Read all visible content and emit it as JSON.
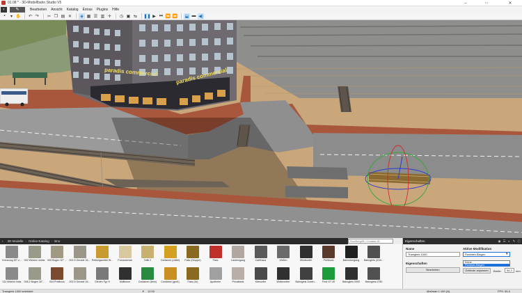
{
  "window": {
    "title": "01.08 * - 3D-Modellbahn Studio V5",
    "minimize": "–",
    "maximize": "□",
    "close": "✕"
  },
  "menubar": {
    "items": [
      "Bearbeiten",
      "Ansicht",
      "Katalog",
      "Extras",
      "Plugins",
      "Hilfe"
    ]
  },
  "scene": {
    "building_sign_1": "paradis commercial",
    "building_sign_2": "paradis commercial"
  },
  "catalog": {
    "breadcrumb": [
      "3D-Modelle",
      "Online-Katalog",
      "Bno"
    ],
    "search_placeholder": "Suchbegriff / Content-ID",
    "items_row1": [
      "Kreuzung 90° z...",
      "002 Weiche rechts",
      "005 Bogen 30° ...",
      "002.5 Gerade 16...",
      "Rettungsmittel W...",
      "Fotoautomat",
      "Tafik 2",
      "Container (mittel)",
      "Fass (Gruppe)",
      "Fass",
      "Laubengang",
      "Caféhaus",
      "Wellen",
      "Windkurfer",
      "Prellbock",
      "Bahnübergang",
      "Bahngleis (410r..."
    ],
    "items_row2": [
      "011 Weiche links",
      "006.2 Bogen 30°...",
      "004 Prellbock",
      "002.5 Gerade 16...",
      "Citroën Typ H",
      "Mülltonne",
      "Container (klein)",
      "Container (groß)",
      "Fass (4x)",
      "Apotheke",
      "Privatbank",
      "Kitesurfer",
      "Wellenreiter",
      "Bahngleis Zubeh...",
      "Ford GT 40",
      "Bahngleis 0900",
      "Bahngleis 0750"
    ],
    "row1_colors": [
      "#8a8a8a",
      "#9a9a8a",
      "#a09a85",
      "#9a968a",
      "#c89a30",
      "#d8c8a0",
      "#c8b070",
      "#d4a020",
      "#8a6a20",
      "#c0302a",
      "#b0a8a0",
      "#5a5a5a",
      "#6a6a6a",
      "#303030",
      "#5a3a2a",
      "#202020",
      "#505050"
    ],
    "row2_colors": [
      "#8a8a8a",
      "#9a9a8a",
      "#7a4a30",
      "#9a968a",
      "#7a7a7a",
      "#303030",
      "#2a8a40",
      "#c89020",
      "#8a6a20",
      "#a0a0a0",
      "#b8b0a8",
      "#4a4a4a",
      "#303030",
      "#404040",
      "#1a9a3a",
      "#303030",
      "#505050"
    ]
  },
  "properties": {
    "header": "Eigenschaften",
    "name_label": "Name",
    "name_value": "Tramgleis 1000",
    "props_label": "Eigenschaften",
    "edit_button": "Bearbeiten",
    "modification_label": "Aktive Modifikation",
    "modification_value": "Flexibles Biegen",
    "dropdown_options": [
      "Keine",
      "Flexibles Biegen"
    ],
    "terrain_button": "Gelände anpassen",
    "width_label": "Breite:",
    "width_value": "54,3",
    "width_unit": "mm"
  },
  "statusbar": {
    "selection": "Tramgleis 1000 selektiert",
    "time": "12:00",
    "scale": "Maßstab 1:160 (N)",
    "fps": "FPS: 55,9"
  }
}
